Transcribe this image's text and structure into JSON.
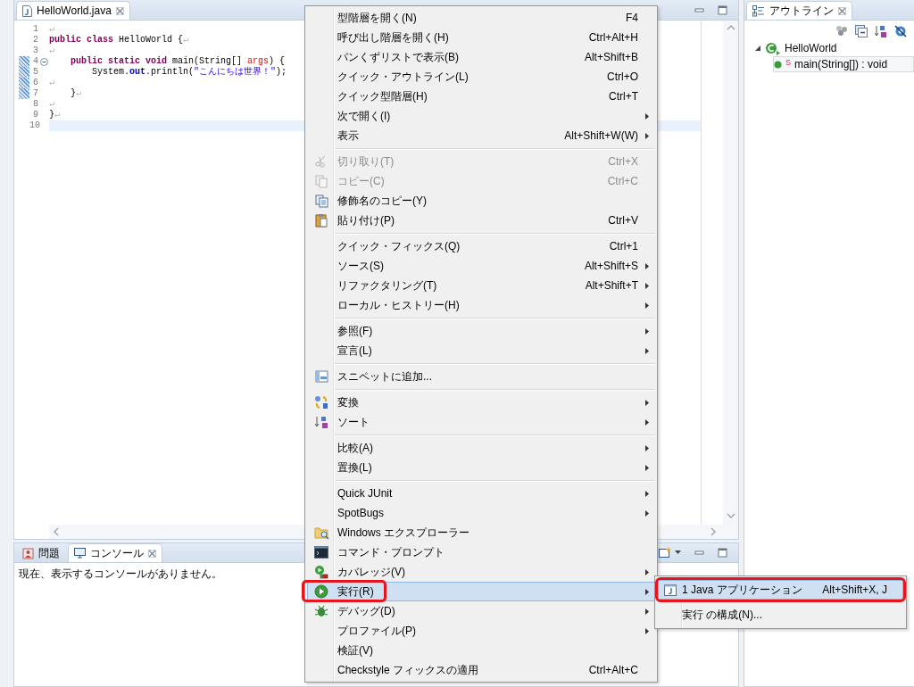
{
  "editor": {
    "tab": {
      "title": "HelloWorld.java",
      "selected": true
    },
    "lines": [
      {
        "number": "1",
        "changed": false,
        "fold": false,
        "current": false,
        "tokens": [
          {
            "kind": "mark",
            "text": "↵"
          }
        ]
      },
      {
        "number": "2",
        "changed": false,
        "fold": false,
        "current": false,
        "tokens": [
          {
            "kind": "keyword",
            "text": "public class"
          },
          {
            "kind": "plain",
            "text": " HelloWorld {"
          },
          {
            "kind": "mark",
            "text": "↵"
          }
        ]
      },
      {
        "number": "3",
        "changed": false,
        "fold": false,
        "current": false,
        "tokens": [
          {
            "kind": "mark",
            "text": "↵"
          }
        ]
      },
      {
        "number": "4",
        "changed": true,
        "fold": true,
        "current": false,
        "tokens": [
          {
            "kind": "keyword",
            "text": "    public static void"
          },
          {
            "kind": "plain",
            "text": " main(String[] "
          },
          {
            "kind": "param",
            "text": "args"
          },
          {
            "kind": "plain",
            "text": ") {"
          }
        ]
      },
      {
        "number": "5",
        "changed": true,
        "fold": false,
        "current": false,
        "tokens": [
          {
            "kind": "plain",
            "text": "        System."
          },
          {
            "kind": "field",
            "text": "out"
          },
          {
            "kind": "plain",
            "text": ".println("
          },
          {
            "kind": "string",
            "text": "\"こんにちは世界！\""
          },
          {
            "kind": "plain",
            "text": ");"
          }
        ]
      },
      {
        "number": "6",
        "changed": true,
        "fold": false,
        "current": false,
        "tokens": [
          {
            "kind": "mark",
            "text": "↵"
          }
        ]
      },
      {
        "number": "7",
        "changed": true,
        "fold": false,
        "current": false,
        "tokens": [
          {
            "kind": "plain",
            "text": "    }"
          },
          {
            "kind": "mark",
            "text": "↵"
          }
        ]
      },
      {
        "number": "8",
        "changed": false,
        "fold": false,
        "current": false,
        "tokens": [
          {
            "kind": "mark",
            "text": "↵"
          }
        ]
      },
      {
        "number": "9",
        "changed": false,
        "fold": false,
        "current": false,
        "tokens": [
          {
            "kind": "plain",
            "text": "}"
          },
          {
            "kind": "mark",
            "text": "↵"
          }
        ]
      },
      {
        "number": "10",
        "changed": false,
        "fold": false,
        "current": true
      }
    ]
  },
  "console": {
    "tabs": [
      {
        "label": "問題",
        "selected": false
      },
      {
        "label": "コンソール",
        "selected": true
      }
    ],
    "message": "現在、表示するコンソールがありません。"
  },
  "outline": {
    "tab": {
      "title": "アウトライン",
      "selected": true
    },
    "tree": [
      {
        "label": "HelloWorld",
        "kind": "class",
        "expanded": true,
        "selected": false,
        "children": [
          {
            "label": "main(String[]) : void",
            "kind": "method",
            "modifier": "S",
            "selected": true
          }
        ]
      }
    ]
  },
  "context_menu": {
    "groups": [
      [
        {
          "label": "型階層を開く(N)",
          "shortcut": "F4",
          "submenu": false,
          "disabled": false,
          "selected": false,
          "annotated": false
        },
        {
          "label": "呼び出し階層を開く(H)",
          "shortcut": "Ctrl+Alt+H",
          "submenu": false,
          "disabled": false,
          "selected": false,
          "annotated": false
        },
        {
          "label": "パンくずリストで表示(B)",
          "shortcut": "Alt+Shift+B",
          "submenu": false,
          "disabled": false,
          "selected": false,
          "annotated": false
        },
        {
          "label": "クイック・アウトライン(L)",
          "shortcut": "Ctrl+O",
          "submenu": false,
          "disabled": false,
          "selected": false,
          "annotated": false
        },
        {
          "label": "クイック型階層(H)",
          "shortcut": "Ctrl+T",
          "submenu": false,
          "disabled": false,
          "selected": false,
          "annotated": false
        },
        {
          "label": "次で開く(I)",
          "submenu": true,
          "disabled": false,
          "selected": false,
          "annotated": false
        },
        {
          "label": "表示",
          "shortcut": "Alt+Shift+W(W)",
          "submenu": true,
          "disabled": false,
          "selected": false,
          "annotated": false
        }
      ],
      [
        {
          "label": "切り取り(T)",
          "shortcut": "Ctrl+X",
          "kind": "scissors",
          "submenu": false,
          "disabled": true,
          "selected": false,
          "annotated": false
        },
        {
          "label": "コピー(C)",
          "shortcut": "Ctrl+C",
          "kind": "copy",
          "submenu": false,
          "disabled": true,
          "selected": false,
          "annotated": false
        },
        {
          "label": "修飾名のコピー(Y)",
          "kind": "copyq",
          "submenu": false,
          "disabled": false,
          "selected": false,
          "annotated": false
        },
        {
          "label": "貼り付け(P)",
          "shortcut": "Ctrl+V",
          "kind": "paste",
          "submenu": false,
          "disabled": false,
          "selected": false,
          "annotated": false
        }
      ],
      [
        {
          "label": "クイック・フィックス(Q)",
          "shortcut": "Ctrl+1",
          "submenu": false,
          "disabled": false,
          "selected": false,
          "annotated": false
        },
        {
          "label": "ソース(S)",
          "shortcut": "Alt+Shift+S",
          "submenu": true,
          "disabled": false,
          "selected": false,
          "annotated": false
        },
        {
          "label": "リファクタリング(T)",
          "shortcut": "Alt+Shift+T",
          "submenu": true,
          "disabled": false,
          "selected": false,
          "annotated": false
        },
        {
          "label": "ローカル・ヒストリー(H)",
          "submenu": true,
          "disabled": false,
          "selected": false,
          "annotated": false
        }
      ],
      [
        {
          "label": "参照(F)",
          "submenu": true,
          "disabled": false,
          "selected": false,
          "annotated": false
        },
        {
          "label": "宣言(L)",
          "submenu": true,
          "disabled": false,
          "selected": false,
          "annotated": false
        }
      ],
      [
        {
          "label": "スニペットに追加...",
          "kind": "snippet",
          "submenu": false,
          "disabled": false,
          "selected": false,
          "annotated": false
        }
      ],
      [
        {
          "label": "変換",
          "kind": "convert",
          "submenu": true,
          "disabled": false,
          "selected": false,
          "annotated": false
        },
        {
          "label": "ソート",
          "kind": "sort",
          "submenu": true,
          "disabled": false,
          "selected": false,
          "annotated": false
        }
      ],
      [
        {
          "label": "比較(A)",
          "submenu": true,
          "disabled": false,
          "selected": false,
          "annotated": false
        },
        {
          "label": "置換(L)",
          "submenu": true,
          "disabled": false,
          "selected": false,
          "annotated": false
        }
      ],
      [
        {
          "label": "Quick JUnit",
          "submenu": true,
          "disabled": false,
          "selected": false,
          "annotated": false
        },
        {
          "label": "SpotBugs",
          "submenu": true,
          "disabled": false,
          "selected": false,
          "annotated": false
        },
        {
          "label": "Windows エクスプローラー",
          "kind": "explorer",
          "submenu": false,
          "disabled": false,
          "selected": false,
          "annotated": false
        },
        {
          "label": "コマンド・プロンプト",
          "kind": "terminal",
          "submenu": false,
          "disabled": false,
          "selected": false,
          "annotated": false
        },
        {
          "label": "カバレッジ(V)",
          "kind": "coverage",
          "submenu": true,
          "disabled": false,
          "selected": false,
          "annotated": false
        },
        {
          "label": "実行(R)",
          "kind": "run",
          "submenu": true,
          "disabled": false,
          "selected": true,
          "annotated": true
        },
        {
          "label": "デバッグ(D)",
          "kind": "debug",
          "submenu": true,
          "disabled": false,
          "selected": false,
          "annotated": false
        },
        {
          "label": "プロファイル(P)",
          "submenu": true,
          "disabled": false,
          "selected": false,
          "annotated": false
        },
        {
          "label": "検証(V)",
          "submenu": false,
          "disabled": false,
          "selected": false,
          "annotated": false
        },
        {
          "label": "Checkstyle フィックスの適用",
          "shortcut": "Ctrl+Alt+C",
          "submenu": false,
          "disabled": false,
          "selected": false,
          "annotated": false
        }
      ]
    ]
  },
  "submenu": {
    "items": [
      {
        "label": "1 Java アプリケーション",
        "shortcut": "Alt+Shift+X, J",
        "kind": "app",
        "selected": true,
        "annotated": true
      },
      {
        "label": "実行 の構成(N)...",
        "selected": false,
        "annotated": false
      }
    ]
  }
}
